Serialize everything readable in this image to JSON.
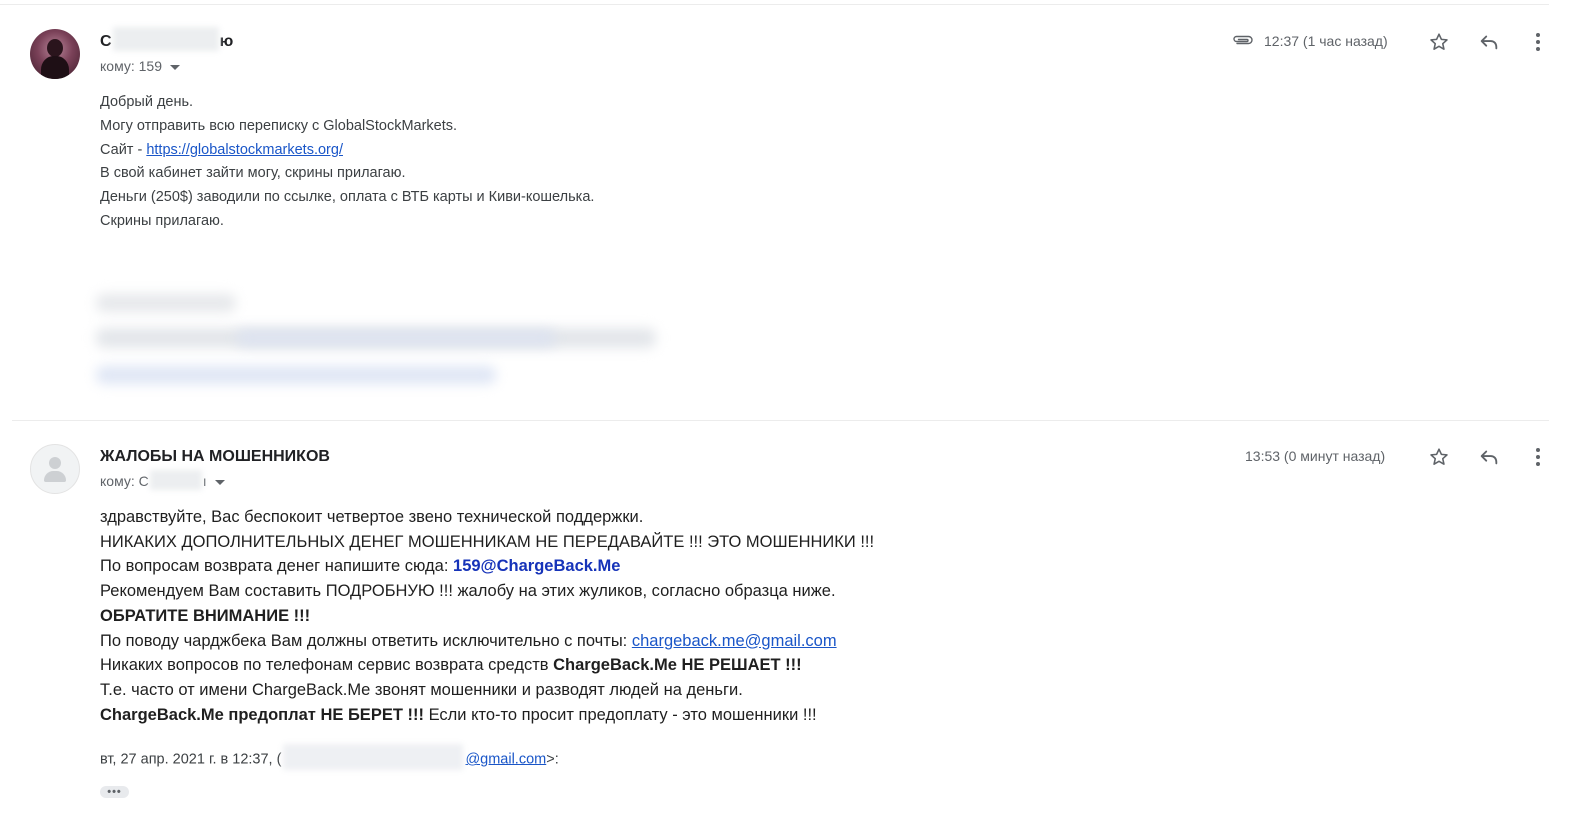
{
  "message1": {
    "sender_prefix": "С",
    "sender_suffix": "ю",
    "to_label": "кому: 159",
    "time": "12:37 (1 час назад)",
    "body": [
      "Добрый день.",
      "Могу отправить всю переписку с GlobalStockMarkets.",
      {
        "prefix": "Сайт - ",
        "link": "https://globalstockmarkets.org/"
      },
      "В свой кабинет зайти могу, скрины прилагаю.",
      "Деньги (250$) заводили по ссылке, оплата с ВТБ карты и Киви-кошелька.",
      "Скрины прилагаю."
    ]
  },
  "message2": {
    "sender": "ЖАЛОБЫ НА МОШЕННИКОВ",
    "to_prefix": "кому: С",
    "to_suffix": "ı",
    "time": "13:53 (0 минут назад)",
    "lines": {
      "l1": "здравствуйте, Вас беспокоит четвертое звено технической поддержки.",
      "l2": "НИКАКИХ ДОПОЛНИТЕЛЬНЫХ ДЕНЕГ МОШЕННИКАМ НЕ ПЕРЕДАВАЙТЕ !!! ЭТО МОШЕННИКИ !!!",
      "l3_text": "По вопросам возврата денег напишите сюда: ",
      "l3_email": "159@ChargeBack.Me",
      "l4": "Рекомендуем Вам составить ПОДРОБНУЮ !!! жалобу на этих жуликов, согласно образца ниже.",
      "l5": "ОБРАТИТЕ ВНИМАНИЕ !!!",
      "l6_text": "По поводу чарджбека Вам должны ответить исключительно с почты: ",
      "l6_link": "chargeback.me@gmail.com",
      "l7_text": "Никаких вопросов по телефонам сервис возврата средств ",
      "l7_bold": "ChargeBack.Me НЕ РЕШАЕТ !!!",
      "l8": "Т.е. часто от имени ChargeBack.Me звонят мошенники и разводят людей на деньги.",
      "l9_bold": "ChargeBack.Me предоплат НЕ БЕРЕТ !!!",
      "l9_text": " Если кто-то просит предоплату - это мошенники !!!"
    },
    "quote_prefix": "вт, 27 апр. 2021 г. в 12:37, (",
    "quote_email": "@gmail.com",
    "quote_suffix": ">:",
    "ellipsis": "•••"
  },
  "icons": {
    "attachment": "paperclip-icon",
    "star": "star-icon",
    "reply": "reply-icon",
    "more": "more-vert-icon"
  },
  "colors": {
    "link": "#1a56c8",
    "email_highlight": "#1633b9",
    "secondary_text": "#5f6368"
  }
}
